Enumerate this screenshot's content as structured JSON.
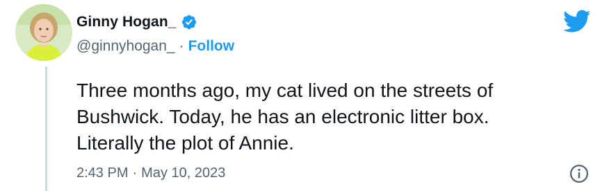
{
  "author": {
    "display_name": "Ginny Hogan_",
    "handle": "@ginnyhogan_",
    "separator": "·",
    "follow_label": "Follow",
    "verified": true,
    "avatar_icon": "profile-photo"
  },
  "tweet": {
    "lines": [
      "Three months ago, my cat lived on the streets of",
      "Bushwick. Today, he has an electronic litter box.",
      "Literally the plot of Annie."
    ],
    "time": "2:43 PM",
    "separator": "·",
    "date": "May 10, 2023"
  },
  "icons": {
    "logo": "twitter-bird-icon",
    "verified": "verified-badge-icon",
    "info": "info-icon"
  },
  "colors": {
    "accent": "#1d9bf0",
    "text": "#0f1419",
    "muted": "#536471",
    "thread_line": "#cfd9de"
  }
}
